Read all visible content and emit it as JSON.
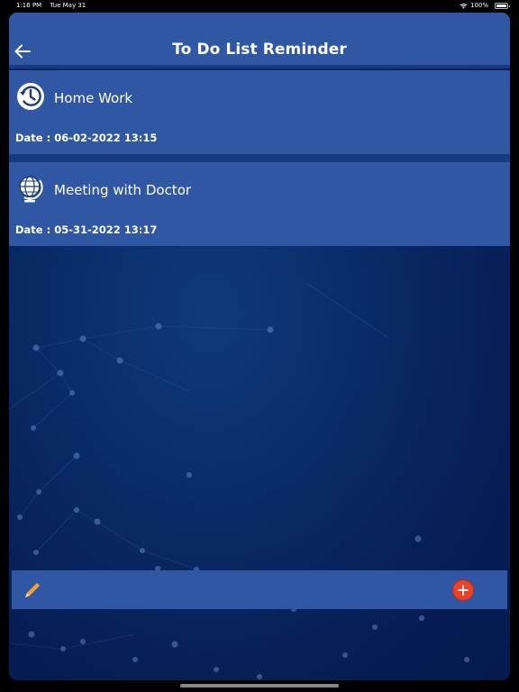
{
  "status_bar": {
    "time": "1:16 PM",
    "date": "Tue May 31",
    "battery": "100%"
  },
  "header": {
    "title": "To Do List Reminder"
  },
  "tasks": [
    {
      "title": "Home Work",
      "date_text": "Date : 06-02-2022 13:15",
      "icon": "history-clock-icon"
    },
    {
      "title": "Meeting with Doctor",
      "date_text": "Date : 05-31-2022 13:17",
      "icon": "globe-icon"
    }
  ],
  "toolbar": {
    "edit_icon": "pencil-icon",
    "add_icon": "plus-icon"
  },
  "colors": {
    "card_bg": "#2f57a3",
    "add_button": "#e8432a",
    "pencil": "#f2a531"
  }
}
